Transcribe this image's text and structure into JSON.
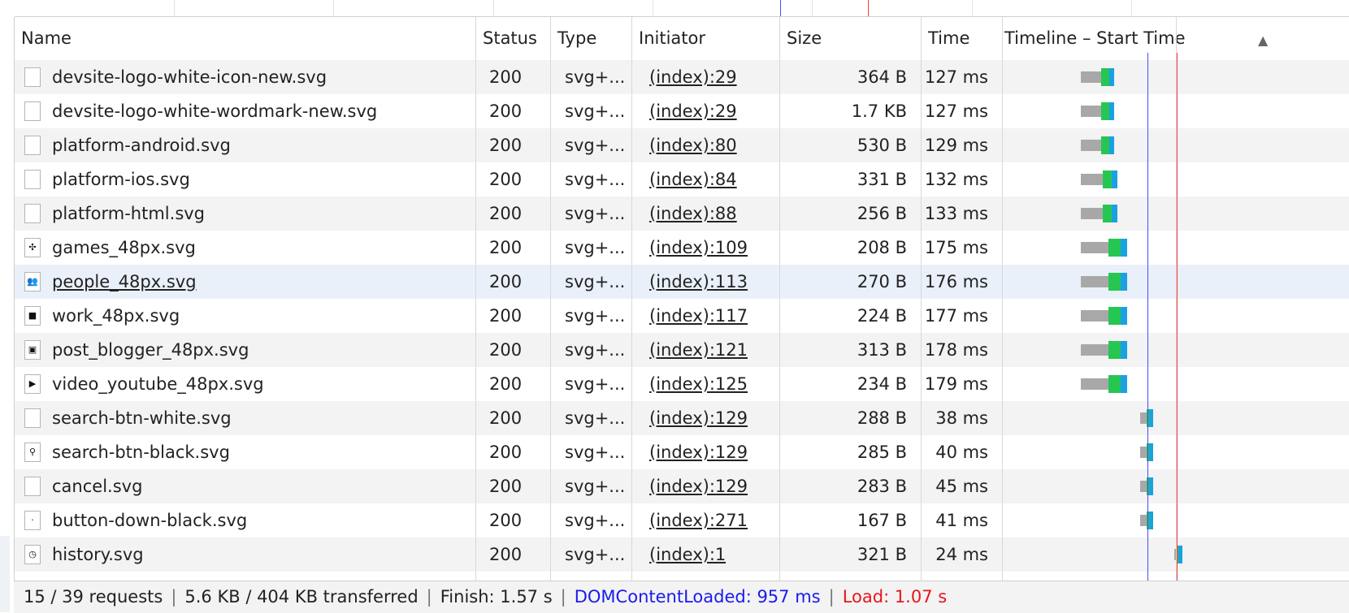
{
  "colors": {
    "dcl_line": "#4a4aff",
    "load_line": "#ff3b3b",
    "wait": "#a8a8a8",
    "green": "#25c752",
    "blue": "#1ba1e2"
  },
  "columns": {
    "name": "Name",
    "status": "Status",
    "type": "Type",
    "initiator": "Initiator",
    "size": "Size",
    "time": "Time",
    "timeline": "Timeline – Start Time",
    "sort_icon": "▲"
  },
  "rows": [
    {
      "name": "devsite-logo-white-icon-new.svg",
      "status": "200",
      "type": "svg+...",
      "initiator": "(index):29",
      "size": "364 B",
      "time": "127 ms",
      "icon": "blank-file-icon",
      "icon_glyph": "",
      "t_start": 0.7,
      "t_end": 0.83
    },
    {
      "name": "devsite-logo-white-wordmark-new.svg",
      "status": "200",
      "type": "svg+...",
      "initiator": "(index):29",
      "size": "1.7 KB",
      "time": "127 ms",
      "icon": "blank-file-icon",
      "icon_glyph": "",
      "t_start": 0.7,
      "t_end": 0.83
    },
    {
      "name": "platform-android.svg",
      "status": "200",
      "type": "svg+...",
      "initiator": "(index):80",
      "size": "530 B",
      "time": "129 ms",
      "icon": "blank-file-icon",
      "icon_glyph": "",
      "t_start": 0.7,
      "t_end": 0.83
    },
    {
      "name": "platform-ios.svg",
      "status": "200",
      "type": "svg+...",
      "initiator": "(index):84",
      "size": "331 B",
      "time": "132 ms",
      "icon": "blank-file-icon",
      "icon_glyph": "",
      "t_start": 0.7,
      "t_end": 0.84
    },
    {
      "name": "platform-html.svg",
      "status": "200",
      "type": "svg+...",
      "initiator": "(index):88",
      "size": "256 B",
      "time": "133 ms",
      "icon": "blank-file-icon",
      "icon_glyph": "",
      "t_start": 0.7,
      "t_end": 0.84
    },
    {
      "name": "games_48px.svg",
      "status": "200",
      "type": "svg+...",
      "initiator": "(index):109",
      "size": "208 B",
      "time": "175 ms",
      "icon": "gamepad-icon",
      "icon_glyph": "✣",
      "t_start": 0.7,
      "t_end": 0.88
    },
    {
      "name": "people_48px.svg",
      "status": "200",
      "type": "svg+...",
      "initiator": "(index):113",
      "size": "270 B",
      "time": "176 ms",
      "icon": "people-icon",
      "icon_glyph": "👥",
      "t_start": 0.7,
      "t_end": 0.88
    },
    {
      "name": "work_48px.svg",
      "status": "200",
      "type": "svg+...",
      "initiator": "(index):117",
      "size": "224 B",
      "time": "177 ms",
      "icon": "briefcase-icon",
      "icon_glyph": "■",
      "t_start": 0.7,
      "t_end": 0.88
    },
    {
      "name": "post_blogger_48px.svg",
      "status": "200",
      "type": "svg+...",
      "initiator": "(index):121",
      "size": "313 B",
      "time": "178 ms",
      "icon": "blogger-icon",
      "icon_glyph": "▣",
      "t_start": 0.7,
      "t_end": 0.88
    },
    {
      "name": "video_youtube_48px.svg",
      "status": "200",
      "type": "svg+...",
      "initiator": "(index):125",
      "size": "234 B",
      "time": "179 ms",
      "icon": "youtube-icon",
      "icon_glyph": "▶",
      "t_start": 0.7,
      "t_end": 0.88
    },
    {
      "name": "search-btn-white.svg",
      "status": "200",
      "type": "svg+...",
      "initiator": "(index):129",
      "size": "288 B",
      "time": "38 ms",
      "icon": "blank-file-icon",
      "icon_glyph": "",
      "t_start": 0.93,
      "t_end": 0.97
    },
    {
      "name": "search-btn-black.svg",
      "status": "200",
      "type": "svg+...",
      "initiator": "(index):129",
      "size": "285 B",
      "time": "40 ms",
      "icon": "search-icon",
      "icon_glyph": "⚲",
      "t_start": 0.93,
      "t_end": 0.97
    },
    {
      "name": "cancel.svg",
      "status": "200",
      "type": "svg+...",
      "initiator": "(index):129",
      "size": "283 B",
      "time": "45 ms",
      "icon": "blank-file-icon",
      "icon_glyph": "",
      "t_start": 0.93,
      "t_end": 0.97
    },
    {
      "name": "button-down-black.svg",
      "status": "200",
      "type": "svg+...",
      "initiator": "(index):271",
      "size": "167 B",
      "time": "41 ms",
      "icon": "dot-file-icon",
      "icon_glyph": "·",
      "t_start": 0.93,
      "t_end": 0.97
    },
    {
      "name": "history.svg",
      "status": "200",
      "type": "svg+...",
      "initiator": "(index):1",
      "size": "321 B",
      "time": "24 ms",
      "icon": "history-icon",
      "icon_glyph": "◷",
      "t_start": 1.06,
      "t_end": 1.08
    }
  ],
  "selected_row": 6,
  "footer": {
    "requests": "15 / 39 requests",
    "transferred": "5.6 KB / 404 KB transferred",
    "finish": "Finish: 1.57 s",
    "dcl": "DOMContentLoaded: 957 ms",
    "load": "Load: 1.07 s",
    "separator": "|"
  },
  "timeline_markers": {
    "dcl_s": 0.957,
    "load_s": 1.07
  }
}
